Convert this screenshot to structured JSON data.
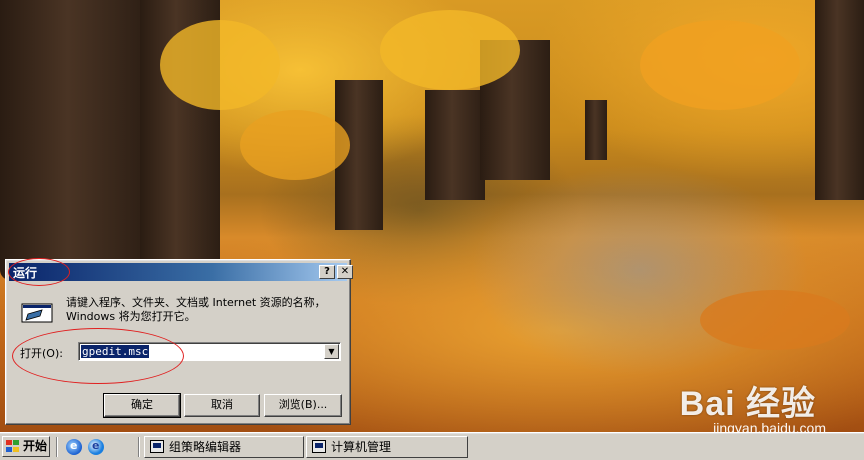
{
  "taskbar_top_text": "",
  "dialog": {
    "title": "运行",
    "help_button": "?",
    "close_button": "✕",
    "prompt": "请键入程序、文件夹、文档或 Internet 资源的名称，Windows 将为您打开它。",
    "open_label": "打开(O):",
    "command_value": "gpedit.msc",
    "ok_label": "确定",
    "cancel_label": "取消",
    "browse_label": "浏览(B)..."
  },
  "taskbar": {
    "start_label": "开始",
    "tasks": [
      {
        "label": "组策略编辑器"
      },
      {
        "label": "计算机管理"
      }
    ]
  },
  "watermark": {
    "logo": "Bai 经验",
    "url": "jingyan.baidu.com"
  },
  "colors": {
    "titlebar": "#0a246a",
    "face": "#d4d0c8",
    "annotation": "#e02020"
  }
}
